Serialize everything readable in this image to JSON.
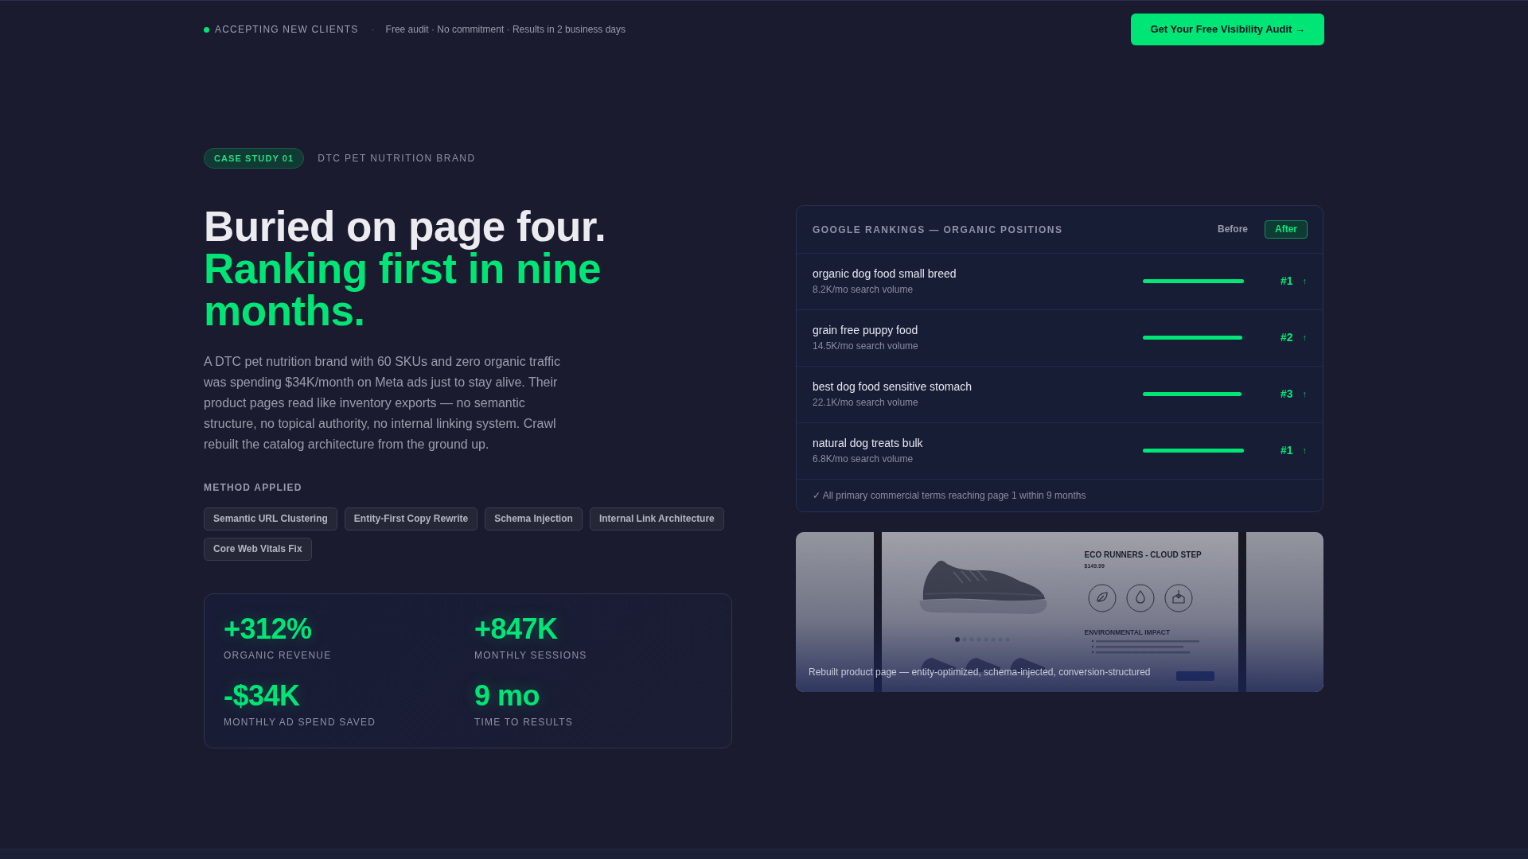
{
  "top_bar": {
    "status": "ACCEPTING NEW CLIENTS",
    "separator": "·",
    "note": "Free audit · No commitment · Results in 2 business days",
    "cta": "Get Your Free Visibility Audit →"
  },
  "case_study": {
    "badge": "CASE STUDY 01",
    "client": "DTC PET NUTRITION BRAND"
  },
  "headline": {
    "line_1": "Buried on page four.",
    "line_2": "Ranking first in nine months."
  },
  "description": "A DTC pet nutrition brand with 60 SKUs and zero organic traffic was spending $34K/month on Meta ads just to stay alive. Their product pages read like inventory exports — no semantic structure, no topical authority, no internal linking system. Crawl rebuilt the catalog architecture from the ground up.",
  "method": {
    "heading": "METHOD APPLIED",
    "tags": [
      "Semantic URL Clustering",
      "Entity-First Copy Rewrite",
      "Schema Injection",
      "Internal Link Architecture",
      "Core Web Vitals Fix"
    ]
  },
  "stats": [
    {
      "value": "+312%",
      "label": "ORGANIC REVENUE"
    },
    {
      "value": "+847K",
      "label": "MONTHLY SESSIONS"
    },
    {
      "value": "-$34K",
      "label": "MONTHLY AD SPEND SAVED"
    },
    {
      "value": "9 mo",
      "label": "TIME TO RESULTS"
    }
  ],
  "rankings": {
    "title": "GOOGLE RANKINGS — ORGANIC POSITIONS",
    "view_toggle": [
      {
        "label": "Before",
        "selected": false
      },
      {
        "label": "After",
        "selected": true
      }
    ],
    "rows": [
      {
        "keyword": "organic dog food small breed",
        "volume": "8.2K/mo search volume",
        "level": 0.98,
        "rank": "#1",
        "trend": "↑"
      },
      {
        "keyword": "grain free puppy food",
        "volume": "14.5K/mo search volume",
        "level": 0.965,
        "rank": "#2",
        "trend": "↑"
      },
      {
        "keyword": "best dog food sensitive stomach",
        "volume": "22.1K/mo search volume",
        "level": 0.955,
        "rank": "#3",
        "trend": "↑"
      },
      {
        "keyword": "natural dog treats bulk",
        "volume": "6.8K/mo search volume",
        "level": 0.98,
        "rank": "#1",
        "trend": "↑"
      }
    ],
    "footer": "✓ All primary commercial terms reaching page 1 within 9 months"
  },
  "showcase": {
    "product_page": {
      "title": "ECO RUNNERS - CLOUD STEP",
      "price": "$149.99",
      "section_heading": "ENVIRONMENTAL IMPACT"
    },
    "caption": "Rebuilt product page — entity-optimized, schema-injected, conversion-structured"
  }
}
